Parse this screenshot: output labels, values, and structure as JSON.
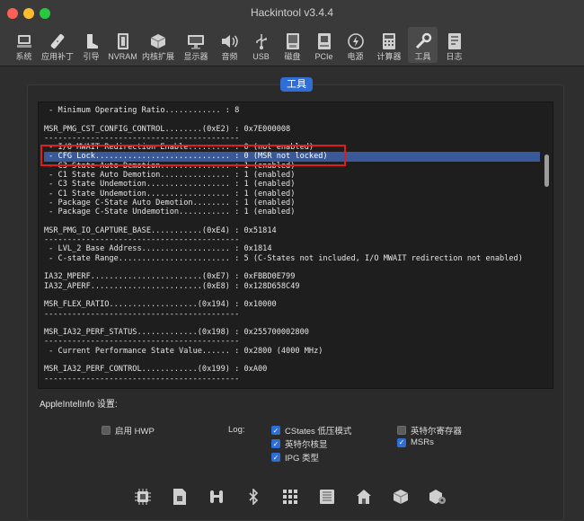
{
  "window": {
    "title": "Hackintool v3.4.4"
  },
  "toolbar": {
    "items": [
      {
        "label": "系统",
        "icon": "system-icon"
      },
      {
        "label": "应用补丁",
        "icon": "patch-icon"
      },
      {
        "label": "引导",
        "icon": "boot-icon"
      },
      {
        "label": "NVRAM",
        "icon": "nvram-icon"
      },
      {
        "label": "内核扩展",
        "icon": "kext-icon"
      },
      {
        "label": "显示器",
        "icon": "display-icon"
      },
      {
        "label": "音频",
        "icon": "audio-icon"
      },
      {
        "label": "USB",
        "icon": "usb-icon"
      },
      {
        "label": "磁盘",
        "icon": "disk-icon"
      },
      {
        "label": "PCIe",
        "icon": "pcie-icon"
      },
      {
        "label": "电源",
        "icon": "power-icon"
      },
      {
        "label": "计算器",
        "icon": "calculator-icon"
      },
      {
        "label": "工具",
        "icon": "tools-icon",
        "active": true
      },
      {
        "label": "日志",
        "icon": "log-icon"
      }
    ]
  },
  "tab": {
    "label": "工具"
  },
  "console": {
    "lines": [
      " - Minimum Operating Ratio............ : 8",
      "",
      "MSR_PMG_CST_CONFIG_CONTROL........(0xE2) : 0x7E000008",
      "------------------------------------------",
      " - I/O MWAIT Redirection Enable......... : 0 (not enabled)",
      " - CFG Lock............................. : 0 (MSR not locked)",
      " - C3 State Auto Demotion............... : 1 (enabled)",
      " - C1 State Auto Demotion............... : 1 (enabled)",
      " - C3 State Undemotion.................. : 1 (enabled)",
      " - C1 State Undemotion.................. : 1 (enabled)",
      " - Package C-State Auto Demotion........ : 1 (enabled)",
      " - Package C-State Undemotion........... : 1 (enabled)",
      "",
      "MSR_PMG_IO_CAPTURE_BASE...........(0xE4) : 0x51814",
      "------------------------------------------",
      " - LVL_2 Base Address................... : 0x1814",
      " - C-state Range........................ : 5 (C-States not included, I/O MWAIT redirection not enabled)",
      "",
      "IA32_MPERF........................(0xE7) : 0xFBBD0E799",
      "IA32_APERF........................(0xE8) : 0x128D658C49",
      "",
      "MSR_FLEX_RATIO...................(0x194) : 0x10000",
      "------------------------------------------",
      "",
      "MSR_IA32_PERF_STATUS.............(0x198) : 0x255700002800",
      "------------------------------------------",
      " - Current Performance State Value...... : 0x2800 (4000 MHz)",
      "",
      "MSR_IA32_PERF_CONTROL............(0x199) : 0xA00",
      "------------------------------------------"
    ]
  },
  "settings": {
    "section_label": "AppleIntelInfo 设置:",
    "hwp": {
      "label": "启用 HWP",
      "checked": false
    },
    "log_label": "Log:",
    "options": [
      {
        "label": "CStates 低压模式",
        "checked": true
      },
      {
        "label": "英特尔核显",
        "checked": true
      },
      {
        "label": "IPG 类型",
        "checked": true
      },
      {
        "label": "英特尔寄存器",
        "checked": false
      },
      {
        "label": "MSRs",
        "checked": true
      }
    ]
  },
  "bottom_icons": [
    "cpu-icon",
    "sd-card-icon",
    "connector-icon",
    "bluetooth-icon",
    "grid-icon",
    "board-icon",
    "home-icon",
    "package-icon",
    "package-settings-icon"
  ],
  "colors": {
    "accent": "#2f6fd5",
    "highlight_box": "#e01d1d"
  }
}
